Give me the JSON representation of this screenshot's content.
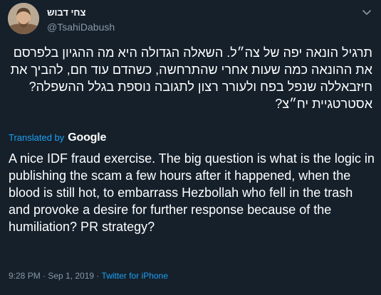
{
  "tweet": {
    "display_name": "צחי דבוש",
    "handle": "@TsahiDabush",
    "original_text": "תרגיל הונאה יפה של צה״ל. השאלה הגדולה היא מה ההגיון בלפרסם את ההונאה כמה שעות אחרי שהתרחשה, כשהדם עוד חם, להביך את חיזבאללה שנפל בפח ולעורר רצון לתגובה נוספת בגלל ההשפלה? אסטרטגיית יח״צ?",
    "translated_by_label": "Translated by",
    "translation_provider": "Google",
    "translated_text": "A nice IDF fraud exercise. The big question is what is the logic in publishing the scam a few hours after it happened, when the blood is still hot, to embarrass Hezbollah who fell in the trash and provoke a desire for further response because of the humiliation? PR strategy?",
    "timestamp": "9:28 PM · Sep 1, 2019",
    "separator": " · ",
    "source": "Twitter for iPhone"
  },
  "icons": {
    "menu": "chevron-down-icon",
    "avatar": "profile-photo"
  },
  "colors": {
    "background": "#15202b",
    "text_primary": "#ffffff",
    "text_secondary": "#8899a6",
    "accent": "#1da1f2"
  }
}
